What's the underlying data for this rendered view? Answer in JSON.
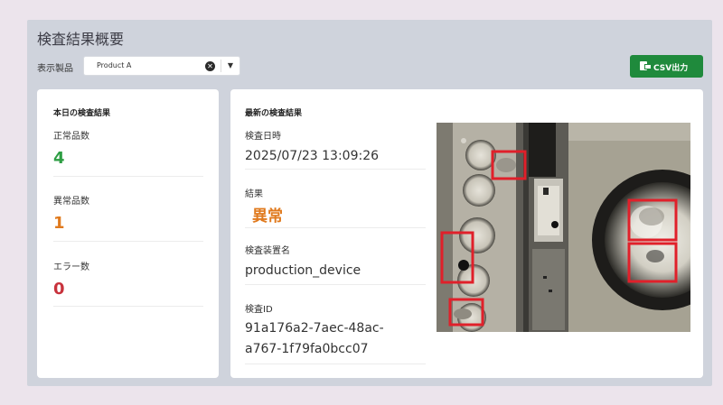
{
  "header": {
    "title": "検査結果概要"
  },
  "filter": {
    "label": "表示製品",
    "selected_product": "Product A",
    "clear_symbol": "✕",
    "arrow_symbol": "▼"
  },
  "actions": {
    "csv_label": "CSV出力"
  },
  "today": {
    "title": "本日の検査結果",
    "normal": {
      "label": "正常品数",
      "value": "4"
    },
    "abnormal": {
      "label": "異常品数",
      "value": "1"
    },
    "errors": {
      "label": "エラー数",
      "value": "0"
    }
  },
  "latest": {
    "title": "最新の検査結果",
    "datetime": {
      "label": "検査日時",
      "value": "2025/07/23 13:09:26"
    },
    "result": {
      "label": "結果",
      "value": "異常"
    },
    "device": {
      "label": "検査装置名",
      "value": "production_device"
    },
    "inspection_id": {
      "label": "検査ID",
      "value_line1": "91a176a2-7aec-48ac-",
      "value_line2": "a767-1f79fa0bcc07"
    }
  },
  "colors": {
    "normal_green": "#2e9e44",
    "abnormal_orange": "#e07a1e",
    "error_red": "#c8323c",
    "csv_button_green": "#1f8a3c",
    "defect_box_red": "#e0202a"
  }
}
